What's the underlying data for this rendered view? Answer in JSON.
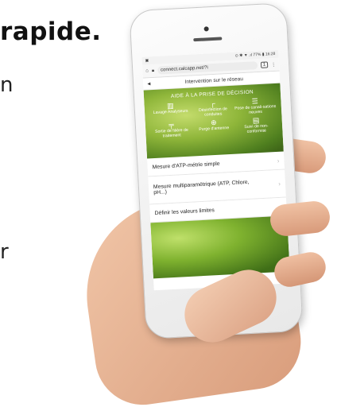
{
  "page": {
    "heading": "rapide.",
    "fragments": [
      "n",
      "r"
    ]
  },
  "phone": {
    "status_bar": {
      "left": "▣",
      "right": "⊙ ✱ ▼ .ıl 77% ▮ 16:28"
    },
    "browser": {
      "url": "connect.calcapp.net/?i",
      "tab_count": "1"
    },
    "nav": {
      "back": "◄",
      "title": "Intervention sur le réseau"
    },
    "hero": {
      "title": "AIDE À LA PRISE DE DÉCISION",
      "buttons": [
        {
          "label": "Lavage Analyseurs",
          "icon": "filter-icon"
        },
        {
          "label": "Désinfection de conduites",
          "icon": "pipe-icon"
        },
        {
          "label": "Pose de canali-sations neuves",
          "icon": "pipes-icon"
        },
        {
          "label": "Sortie de filière de traitement",
          "icon": "tap-icon"
        },
        {
          "label": "Purge d'antenne",
          "icon": "valve-icon"
        },
        {
          "label": "Suivi de non-conformité",
          "icon": "document-icon"
        }
      ]
    },
    "menu": [
      {
        "label": "Mesure d'ATP-métrie simple"
      },
      {
        "label": "Mesure multiparamétrique (ATP, Chlore, pH...)"
      },
      {
        "label": "Définir les valeurs limites"
      }
    ]
  }
}
